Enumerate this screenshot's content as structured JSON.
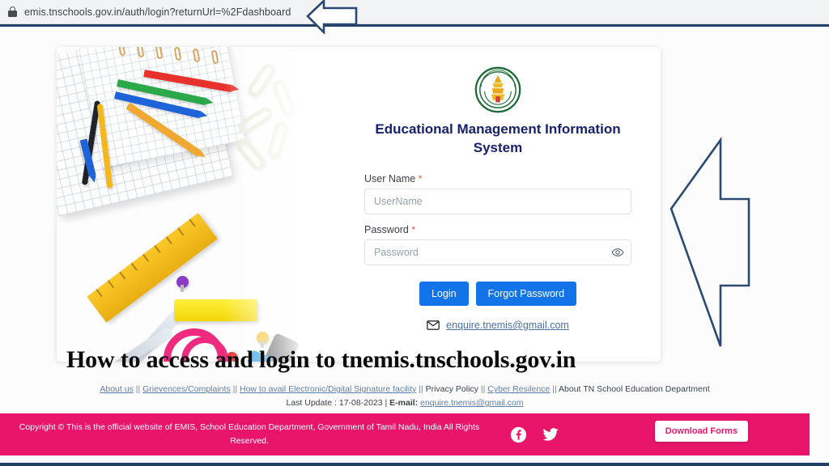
{
  "browser": {
    "url": "emis.tnschools.gov.in/auth/login?returnUrl=%2Fdashboard",
    "lock_icon": "lock-icon"
  },
  "login": {
    "logo_alt": "tamil-nadu-government-emblem",
    "title": "Educational Management Information System",
    "username": {
      "label": "User Name",
      "required_mark": "*",
      "placeholder": "UserName",
      "value": ""
    },
    "password": {
      "label": "Password",
      "required_mark": "*",
      "placeholder": "Password",
      "value": "",
      "toggle_icon": "eye-icon"
    },
    "login_button": "Login",
    "forgot_button": "Forgot Password",
    "contact_email": "enquire.tnemis@gmail.com",
    "mail_icon": "envelope-icon"
  },
  "overlay": {
    "headline": "How to access and login to tnemis.tnschools.gov.in",
    "arrow_big": "left-arrow-annotation",
    "arrow_small": "left-arrow-annotation-url"
  },
  "footer": {
    "links": [
      "About us",
      "Grievences/Complaints",
      "How to avail Electronic/Digital Signature facility",
      "Privacy Policy",
      "Cyber Resilence",
      "About TN School Education Department"
    ],
    "separator": "||",
    "last_update_label": "Last Update : 17-08-2023",
    "pipe": "|",
    "email_label": "E-mail:",
    "email": "enquire.tnemis@gmail.com"
  },
  "bottom_bar": {
    "copyright": "Copyright © This is the official website of EMIS, School Education Department, Government of Tamil Nadu, India All Rights Reserved.",
    "facebook_icon": "facebook-icon",
    "twitter_icon": "twitter-icon",
    "download_button": "Download Forms"
  },
  "colors": {
    "primary_blue": "#1274e8",
    "title_navy": "#19216c",
    "pink_bar": "#e8156b",
    "arrow_navy": "#2a4a72",
    "page_border": "#223f66",
    "required_red": "#e8543f"
  }
}
